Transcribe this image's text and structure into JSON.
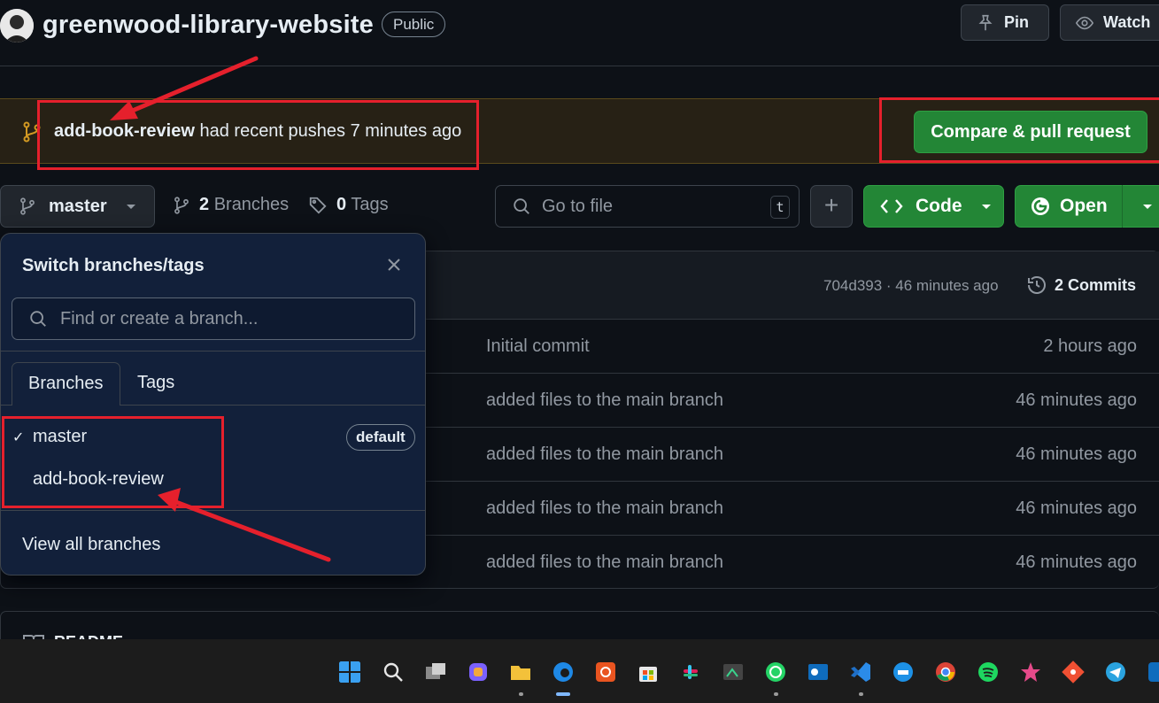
{
  "repo": {
    "name": "greenwood-library-website",
    "visibility": "Public",
    "pin_label": "Pin",
    "watch_label": "Watch"
  },
  "banner": {
    "branch": "add-book-review",
    "message": " had recent pushes 7 minutes ago",
    "compare_label": "Compare & pull request"
  },
  "toolbar": {
    "current_branch": "master",
    "branches_count": "2",
    "branches_label": "Branches",
    "tags_count": "0",
    "tags_label": "Tags",
    "goto_placeholder": "Go to file",
    "goto_shortcut": "t",
    "add_label": "+",
    "code_label": "Code",
    "open_label": "Open"
  },
  "file_table": {
    "commit_meta": "704d393 · 46 minutes ago",
    "commits_label": "2 Commits",
    "rows": [
      {
        "message": "Initial commit",
        "age": "2 hours ago"
      },
      {
        "message": "added files to the main branch",
        "age": "46 minutes ago"
      },
      {
        "message": "added files to the main branch",
        "age": "46 minutes ago"
      },
      {
        "message": "added files to the main branch",
        "age": "46 minutes ago"
      },
      {
        "message": "added files to the main branch",
        "age": "46 minutes ago"
      }
    ]
  },
  "readme": {
    "label": "README"
  },
  "dropdown": {
    "title": "Switch branches/tags",
    "search_placeholder": "Find or create a branch...",
    "tabs": [
      "Branches",
      "Tags"
    ],
    "branches": [
      {
        "name": "master",
        "selected": true,
        "badge": "default"
      },
      {
        "name": "add-book-review",
        "selected": false,
        "badge": ""
      }
    ],
    "view_all": "View all branches"
  },
  "colors": {
    "background": "#0d1117",
    "green_button": "#238636",
    "banner_bg": "#272115",
    "annotation_red": "#e5202c",
    "dropdown_bg": "#12203a"
  },
  "taskbar": {
    "icons": [
      "windows-start-icon",
      "search-icon",
      "task-view-icon",
      "copilot-icon",
      "file-explorer-icon",
      "edge-icon",
      "ubuntu-icon",
      "store-icon",
      "slack-icon",
      "snipping-icon",
      "whatsapp-icon",
      "outlook-icon",
      "vscode-icon",
      "docker-icon",
      "chrome-icon",
      "spotify-icon",
      "app-icon",
      "git-icon",
      "telegram-icon",
      "app-edge-icon"
    ]
  }
}
